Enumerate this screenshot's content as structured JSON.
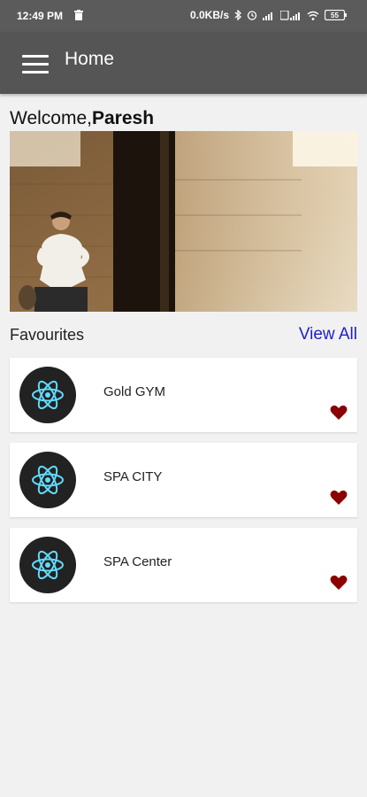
{
  "status_bar": {
    "time": "12:49 PM",
    "network_speed": "0.0KB/s",
    "battery": "55"
  },
  "app_bar": {
    "title": "Home",
    "menu_icon": "hamburger-menu-icon"
  },
  "welcome": {
    "prefix": "Welcome,",
    "user_name": "Paresh"
  },
  "banner": {
    "image": "man-sitting-by-stone-wall-photo"
  },
  "favourites": {
    "label": "Favourites",
    "view_all_label": "View All",
    "items": [
      {
        "name": "Gold GYM",
        "logo_icon": "react-atom-icon",
        "favourite_icon": "heart-icon"
      },
      {
        "name": "SPA CITY",
        "logo_icon": "react-atom-icon",
        "favourite_icon": "heart-icon"
      },
      {
        "name": "SPA Center",
        "logo_icon": "react-atom-icon",
        "favourite_icon": "heart-icon"
      }
    ]
  },
  "colors": {
    "status_bar": "#5b5b5b",
    "app_bar": "#555555",
    "background": "#f1f1f1",
    "link": "#2020c8",
    "heart": "#8b0000",
    "react_logo": "#61dafb"
  }
}
